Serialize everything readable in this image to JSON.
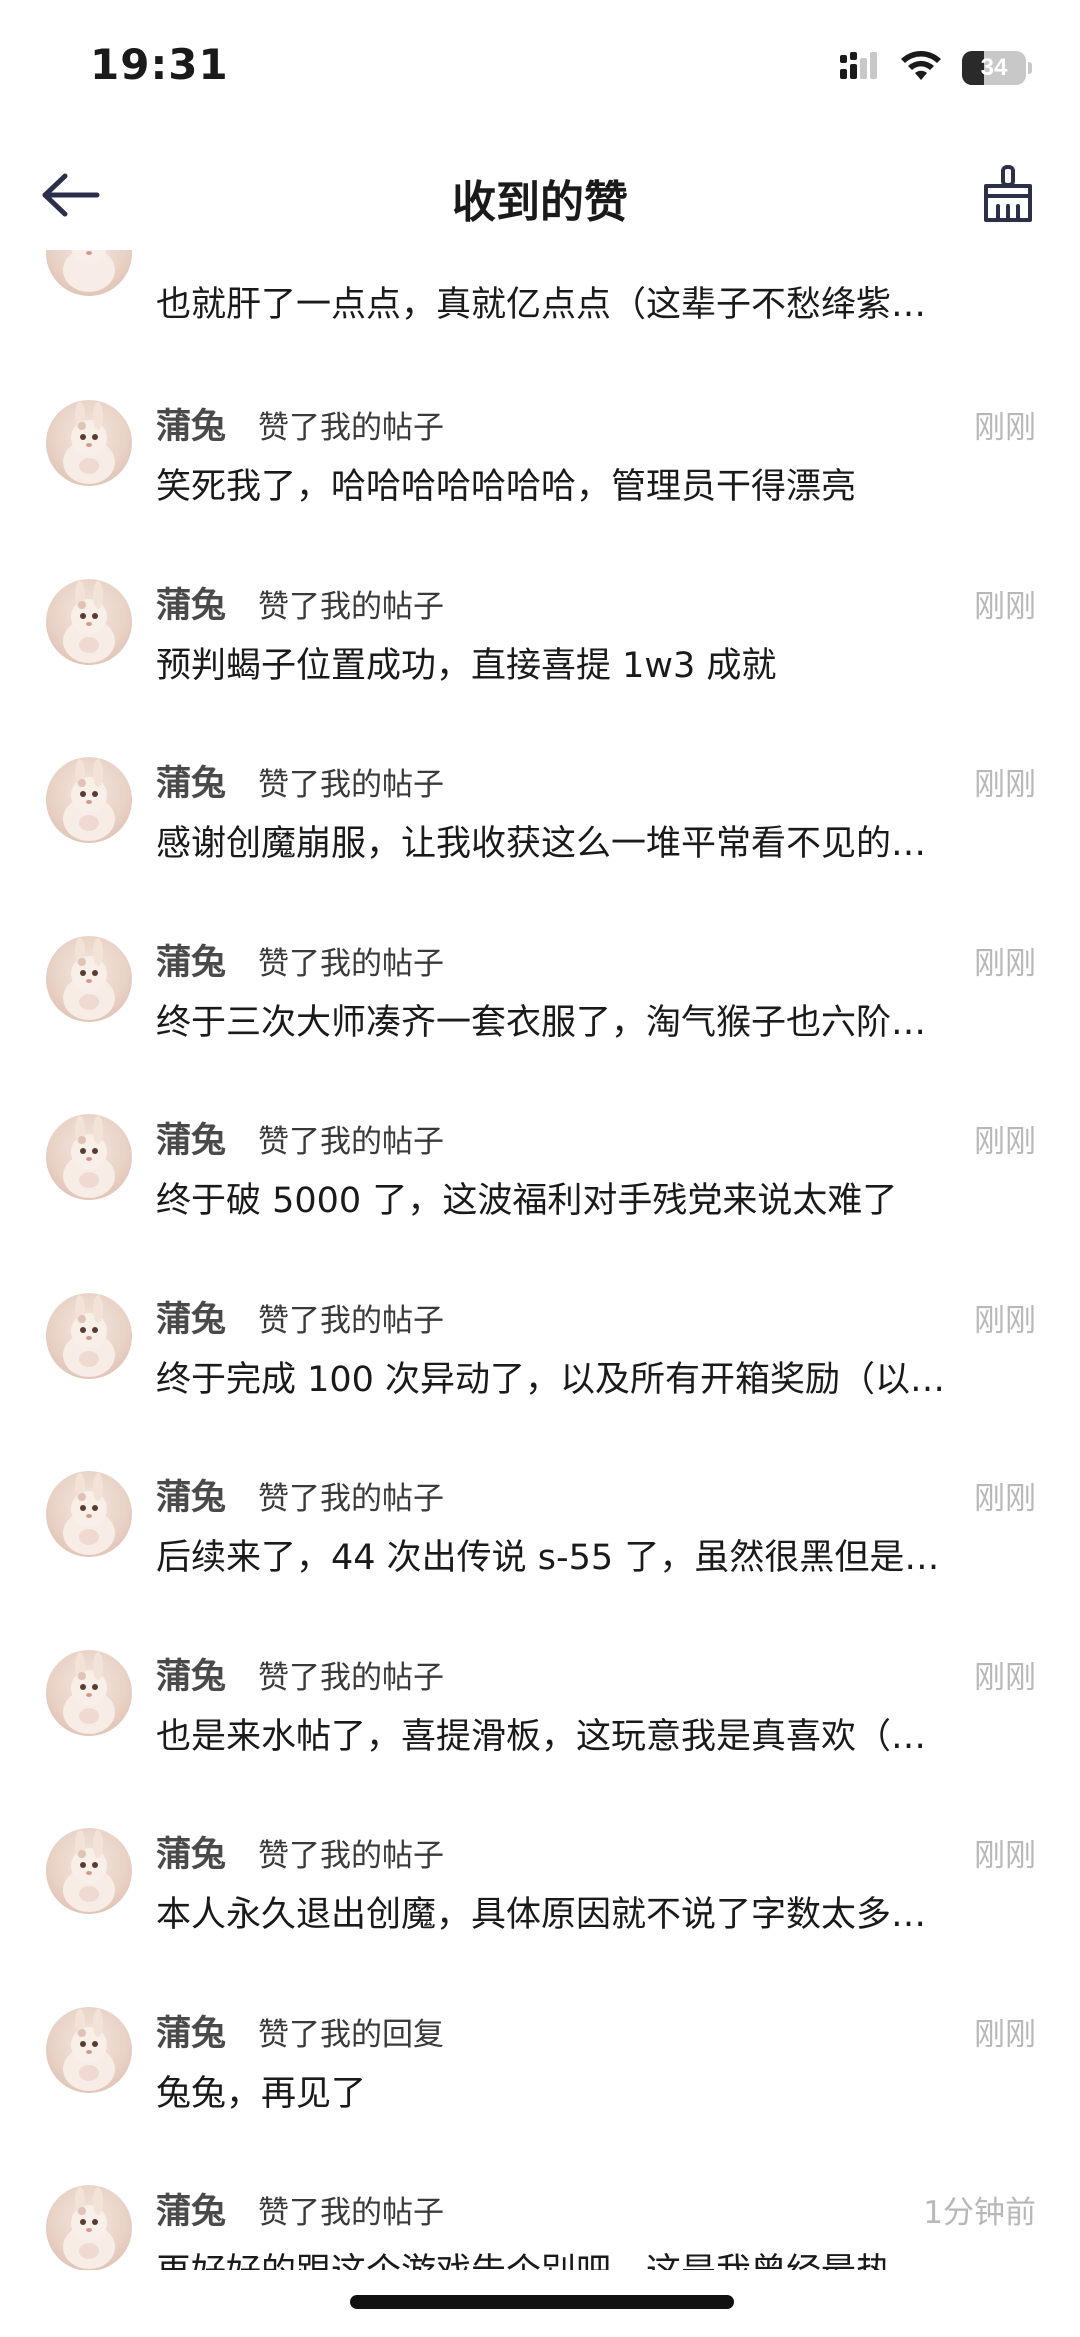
{
  "status_bar": {
    "time": "19:31",
    "battery": "34",
    "battery_level": 0.34,
    "icons": [
      "cellular-signal-icon",
      "wifi-icon",
      "battery-icon"
    ]
  },
  "nav": {
    "title": "收到的赞",
    "back_icon": "back-arrow-icon",
    "clear_icon": "broom-icon"
  },
  "first_partial_item": {
    "text": "也就肝了一点点，真就亿点点（这辈子不愁绛紫…"
  },
  "items": [
    {
      "user": "蒲兔",
      "action": "赞了我的帖子",
      "time": "刚刚",
      "text": "笑死我了，哈哈哈哈哈哈哈，管理员干得漂亮"
    },
    {
      "user": "蒲兔",
      "action": "赞了我的帖子",
      "time": "刚刚",
      "text": "预判蝎子位置成功，直接喜提 1w3 成就"
    },
    {
      "user": "蒲兔",
      "action": "赞了我的帖子",
      "time": "刚刚",
      "text": "感谢创魔崩服，让我收获这么一堆平常看不见的…"
    },
    {
      "user": "蒲兔",
      "action": "赞了我的帖子",
      "time": "刚刚",
      "text": "终于三次大师凑齐一套衣服了，淘气猴子也六阶…"
    },
    {
      "user": "蒲兔",
      "action": "赞了我的帖子",
      "time": "刚刚",
      "text": "终于破 5000 了，这波福利对手残党来说太难了"
    },
    {
      "user": "蒲兔",
      "action": "赞了我的帖子",
      "time": "刚刚",
      "text": "终于完成 100 次异动了，以及所有开箱奖励（以…"
    },
    {
      "user": "蒲兔",
      "action": "赞了我的帖子",
      "time": "刚刚",
      "text": "后续来了，44 次出传说 s-55 了，虽然很黑但是…"
    },
    {
      "user": "蒲兔",
      "action": "赞了我的帖子",
      "time": "刚刚",
      "text": "也是来水帖了，喜提滑板，这玩意我是真喜欢（…"
    },
    {
      "user": "蒲兔",
      "action": "赞了我的帖子",
      "time": "刚刚",
      "text": "本人永久退出创魔，具体原因就不说了字数太多…"
    },
    {
      "user": "蒲兔",
      "action": "赞了我的回复",
      "time": "刚刚",
      "text": "兔兔，再见了"
    },
    {
      "user": "蒲兔",
      "action": "赞了我的帖子",
      "time": "1分钟前",
      "text": "再好好的跟这个游戏告个别吧，这是我曾经最热…"
    }
  ]
}
